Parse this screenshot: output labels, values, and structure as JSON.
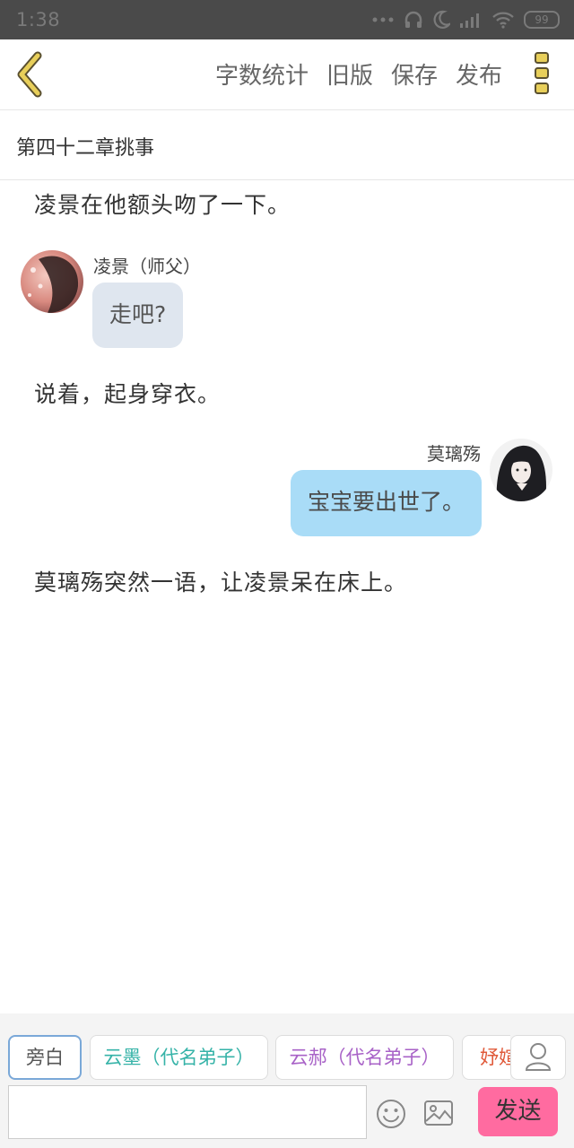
{
  "status_bar": {
    "time": "1:38",
    "battery": "99"
  },
  "toolbar": {
    "actions": [
      "字数统计",
      "旧版",
      "保存",
      "发布"
    ]
  },
  "chapter": {
    "title": "第四十二章挑事"
  },
  "messages": {
    "narration_1": "凌景在他额头吻了一下。",
    "speaker_1_name": "凌景（师父）",
    "bubble_1": "走吧?",
    "narration_2": "说着，起身穿衣。",
    "speaker_2_name": "莫璃殇",
    "bubble_2": "宝宝要出世了。",
    "narration_3": "莫璃殇突然一语，让凌景呆在床上。"
  },
  "bottom": {
    "roles": [
      {
        "label": "旁白",
        "color": "#555555",
        "active": true
      },
      {
        "label": "云墨（代名弟子）",
        "color": "#36b3a8",
        "active": false
      },
      {
        "label": "云郝（代名弟子）",
        "color": "#a862c7",
        "active": false
      },
      {
        "label": "妤媗",
        "color": "#e05a3a",
        "active": false
      }
    ],
    "input_placeholder": "",
    "send_label": "发送"
  },
  "colors": {
    "accent_yellow": "#e8cf5a",
    "send_pink": "#ff6ba0",
    "bubble_left": "#dfe6ef",
    "bubble_right": "#a9dcf7"
  }
}
